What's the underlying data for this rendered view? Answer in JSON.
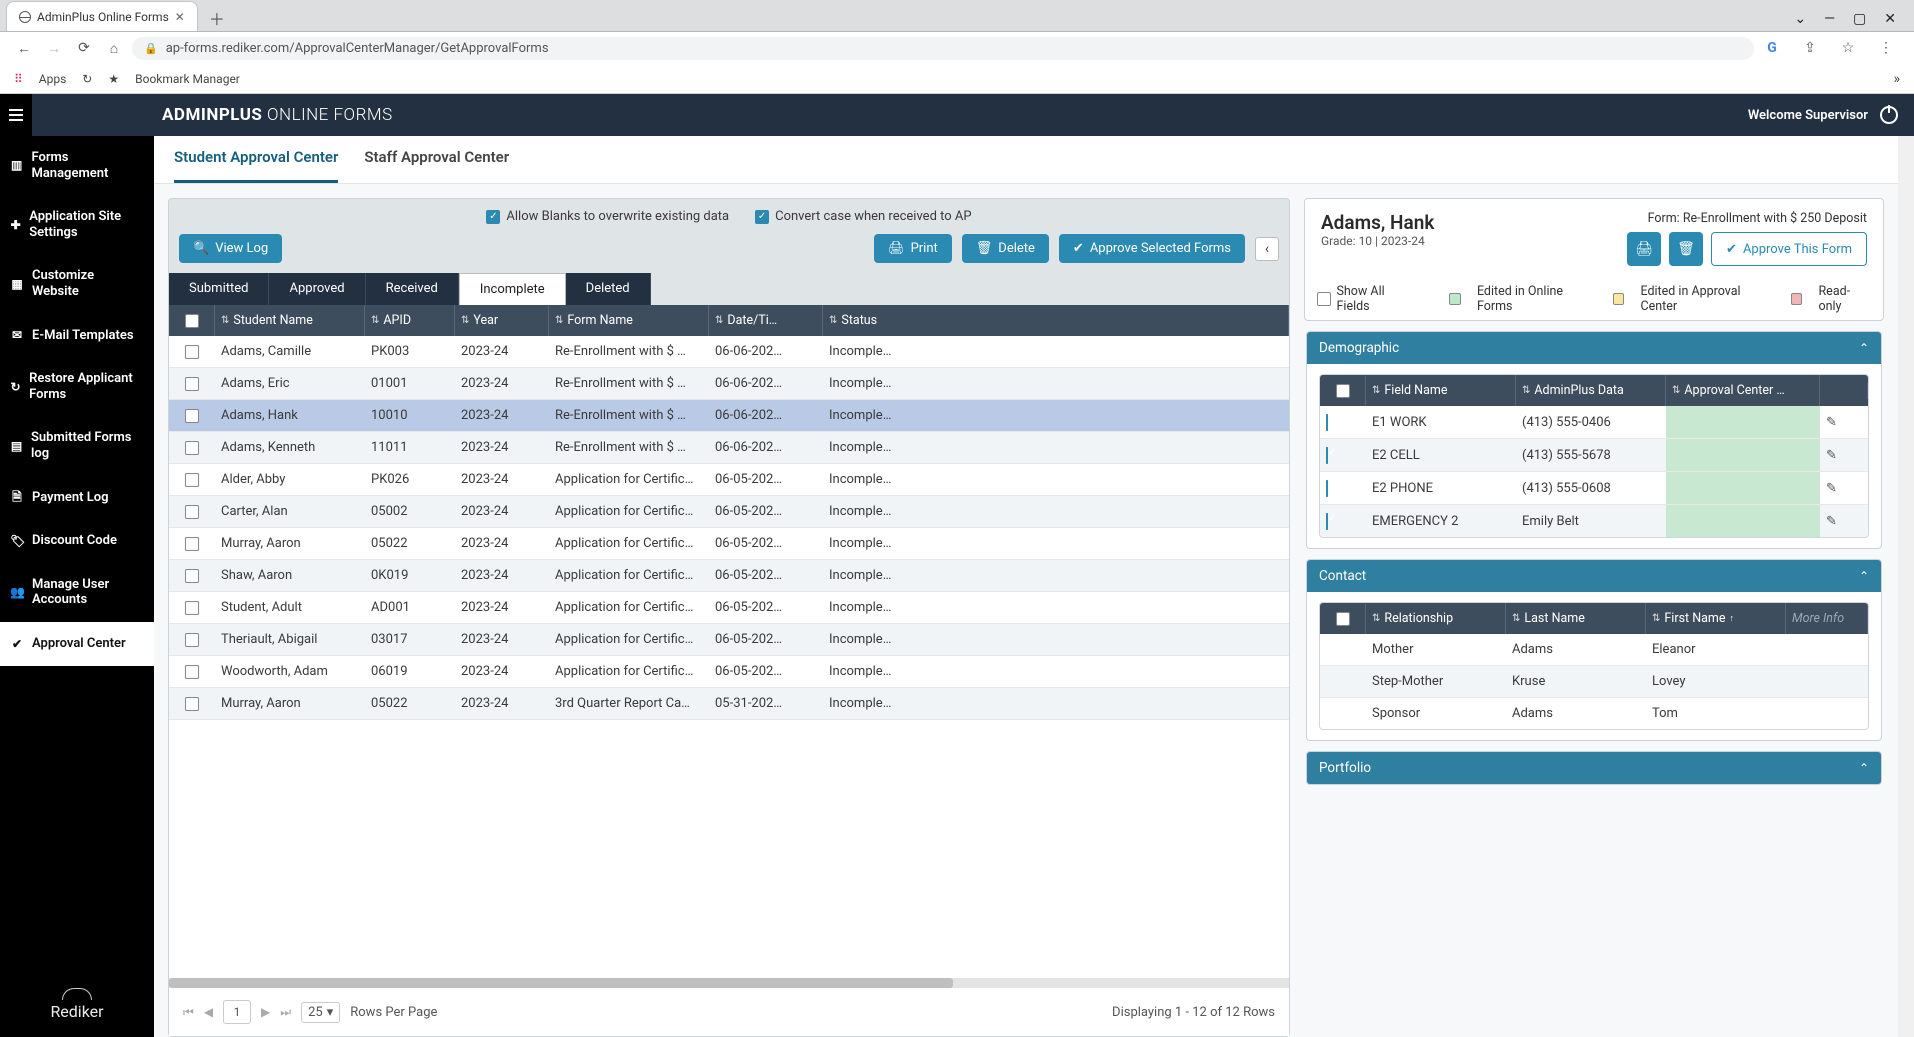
{
  "chrome": {
    "tab_title": "AdminPlus Online Forms",
    "url": "ap-forms.rediker.com/ApprovalCenterManager/GetApprovalForms",
    "apps_label": "Apps",
    "bookmark_mgr": "Bookmark Manager"
  },
  "header": {
    "brand_strong": "ADMINPLUS",
    "brand_thin": " ONLINE FORMS",
    "welcome": "Welcome Supervisor"
  },
  "sidebar": {
    "items": [
      {
        "icon": "▥",
        "label": "Forms Management"
      },
      {
        "icon": "✚",
        "label": "Application Site Settings"
      },
      {
        "icon": "▦",
        "label": "Customize Website"
      },
      {
        "icon": "✉",
        "label": "E-Mail Templates"
      },
      {
        "icon": "↻",
        "label": "Restore Applicant Forms"
      },
      {
        "icon": "▤",
        "label": "Submitted Forms log"
      },
      {
        "icon": "🗎",
        "label": "Payment Log"
      },
      {
        "icon": "🏷",
        "label": "Discount Code"
      },
      {
        "icon": "👥",
        "label": "Manage User Accounts"
      },
      {
        "icon": "✔",
        "label": "Approval Center"
      }
    ],
    "logo": "Rediker"
  },
  "page_tabs": {
    "student": "Student Approval Center",
    "staff": "Staff Approval Center"
  },
  "options": {
    "allow_blanks": "Allow Blanks to overwrite existing data",
    "convert_case": "Convert case when received to AP"
  },
  "actions": {
    "view_log": "View Log",
    "print": "Print",
    "delete": "Delete",
    "approve_selected": "Approve Selected Forms"
  },
  "status_tabs": [
    "Submitted",
    "Approved",
    "Received",
    "Incomplete",
    "Deleted"
  ],
  "grid": {
    "headers": {
      "student": "Student Name",
      "apid": "APID",
      "year": "Year",
      "form": "Form Name",
      "date": "Date/Ti…",
      "status": "Status"
    },
    "rows": [
      {
        "name": "Adams, Camille",
        "apid": "PK003",
        "year": "2023-24",
        "form": "Re-Enrollment with $ …",
        "date": "06-06-202…",
        "status": "Incomple…"
      },
      {
        "name": "Adams, Eric",
        "apid": "01001",
        "year": "2023-24",
        "form": "Re-Enrollment with $ …",
        "date": "06-06-202…",
        "status": "Incomple…"
      },
      {
        "name": "Adams, Hank",
        "apid": "10010",
        "year": "2023-24",
        "form": "Re-Enrollment with $ …",
        "date": "06-06-202…",
        "status": "Incomple…"
      },
      {
        "name": "Adams, Kenneth",
        "apid": "11011",
        "year": "2023-24",
        "form": "Re-Enrollment with $ …",
        "date": "06-06-202…",
        "status": "Incomple…"
      },
      {
        "name": "Alder, Abby",
        "apid": "PK026",
        "year": "2023-24",
        "form": "Application for Certific…",
        "date": "06-05-202…",
        "status": "Incomple…"
      },
      {
        "name": "Carter, Alan",
        "apid": "05002",
        "year": "2023-24",
        "form": "Application for Certific…",
        "date": "06-05-202…",
        "status": "Incomple…"
      },
      {
        "name": "Murray, Aaron",
        "apid": "05022",
        "year": "2023-24",
        "form": "Application for Certific…",
        "date": "06-05-202…",
        "status": "Incomple…"
      },
      {
        "name": "Shaw, Aaron",
        "apid": "0K019",
        "year": "2023-24",
        "form": "Application for Certific…",
        "date": "06-05-202…",
        "status": "Incomple…"
      },
      {
        "name": "Student, Adult",
        "apid": "AD001",
        "year": "2023-24",
        "form": "Application for Certific…",
        "date": "06-05-202…",
        "status": "Incomple…"
      },
      {
        "name": "Theriault, Abigail",
        "apid": "03017",
        "year": "2023-24",
        "form": "Application for Certific…",
        "date": "06-05-202…",
        "status": "Incomple…"
      },
      {
        "name": "Woodworth, Adam",
        "apid": "06019",
        "year": "2023-24",
        "form": "Application for Certific…",
        "date": "06-05-202…",
        "status": "Incomple…"
      },
      {
        "name": "Murray, Aaron",
        "apid": "05022",
        "year": "2023-24",
        "form": "3rd Quarter Report Ca…",
        "date": "05-31-202…",
        "status": "Incomple…"
      }
    ],
    "selected_index": 2,
    "pager": {
      "page": "1",
      "page_size": "25",
      "rows_per_page": "Rows Per Page",
      "displaying": "Displaying 1 - 12 of 12 Rows"
    }
  },
  "detail": {
    "name": "Adams, Hank",
    "grade_label": "Grade:",
    "grade": "10",
    "sep": "  |  ",
    "year": "2023-24",
    "form_label": "Form:",
    "form_name": "Re-Enrollment with $ 250 Deposit",
    "approve_this": "Approve This Form",
    "legend": {
      "show_all": "Show All Fields",
      "edited_forms": "Edited in Online Forms",
      "edited_center": "Edited in Approval Center",
      "readonly": "Read-only"
    },
    "sections": {
      "demographic": {
        "title": "Demographic",
        "headers": {
          "field": "Field Name",
          "apdata": "AdminPlus Data",
          "acdata": "Approval Center …"
        },
        "rows": [
          {
            "field": "E1 WORK",
            "ap": "(413) 555-0406",
            "ac": ""
          },
          {
            "field": "E2 CELL",
            "ap": "(413) 555-5678",
            "ac": ""
          },
          {
            "field": "E2 PHONE",
            "ap": "(413) 555-0608",
            "ac": ""
          },
          {
            "field": "EMERGENCY 2",
            "ap": "Emily Belt",
            "ac": ""
          }
        ]
      },
      "contact": {
        "title": "Contact",
        "headers": {
          "rel": "Relationship",
          "last": "Last Name",
          "first": "First Name",
          "more": "More Info"
        },
        "rows": [
          {
            "rel": "Mother",
            "last": "Adams",
            "first": "Eleanor"
          },
          {
            "rel": "Step-Mother",
            "last": "Kruse",
            "first": "Lovey"
          },
          {
            "rel": "Sponsor",
            "last": "Adams",
            "first": "Tom"
          }
        ]
      },
      "portfolio": {
        "title": "Portfolio"
      }
    }
  }
}
